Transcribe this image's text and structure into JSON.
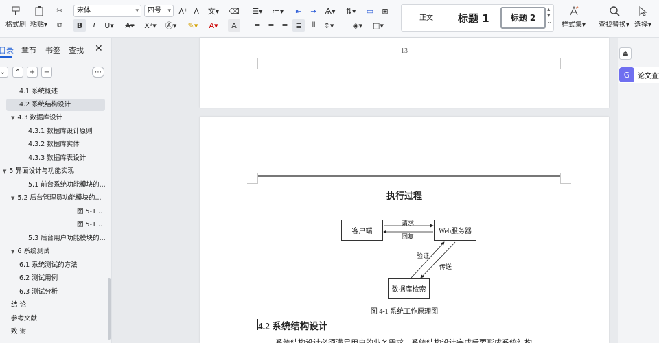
{
  "toolbar": {
    "format_painter": "格式刷",
    "paste": "粘贴",
    "font_name": "宋体",
    "font_size": "四号",
    "style_normal": "正文",
    "style_h1": "标题 1",
    "style_h2": "标题 2",
    "styles_set": "样式集",
    "find_replace": "查找替换",
    "select": "选择"
  },
  "sidebar": {
    "tabs": [
      "目录",
      "章节",
      "书签",
      "查找"
    ],
    "items": [
      {
        "label": "4.1 系统概述",
        "level": 2
      },
      {
        "label": "4.2 系统结构设计",
        "level": 2,
        "selected": true
      },
      {
        "label": "4.3 数据库设计",
        "level": 2,
        "expanded": true
      },
      {
        "label": "4.3.1 数据库设计原则",
        "level": 3
      },
      {
        "label": "4.3.2 数据库实体",
        "level": 3
      },
      {
        "label": "4.3.3 数据库表设计",
        "level": 3
      },
      {
        "label": "5 界面设计与功能实现",
        "level": 1,
        "expanded": true
      },
      {
        "label": "5.1 前台系统功能模块的...",
        "level": 3
      },
      {
        "label": "5.2 后台管理员功能模块的...",
        "level": 2,
        "expanded": true
      },
      {
        "label": "图 5-1...",
        "level": 4
      },
      {
        "label": "图 5-1...",
        "level": 4
      },
      {
        "label": "5.3 后台用户功能模块的...",
        "level": 3
      },
      {
        "label": "6 系统测试",
        "level": 1,
        "expanded": true
      },
      {
        "label": "6.1 系统测试的方法",
        "level": 2
      },
      {
        "label": "6.2 测试用例",
        "level": 2
      },
      {
        "label": "6.3 测试分析",
        "level": 2
      },
      {
        "label": "结 论",
        "level": 1
      },
      {
        "label": "参考文献",
        "level": 1
      },
      {
        "label": "致 谢",
        "level": 1
      }
    ]
  },
  "document": {
    "page_number": "13",
    "diagram_title": "执行过程",
    "nodes": {
      "client": "客户端",
      "server": "Web服务器",
      "db": "数据库检索"
    },
    "edges": {
      "request": "请求",
      "reply": "回复",
      "verify": "验证",
      "transfer": "传送"
    },
    "caption": "图 4-1  系统工作原理图",
    "heading": "4.2  系统结构设计",
    "body_text": "系统结构设计必须满足用户的业务需求，系统结构设计完成后要形成系统结构"
  },
  "right_panel": {
    "ai_label": "论文查重"
  }
}
